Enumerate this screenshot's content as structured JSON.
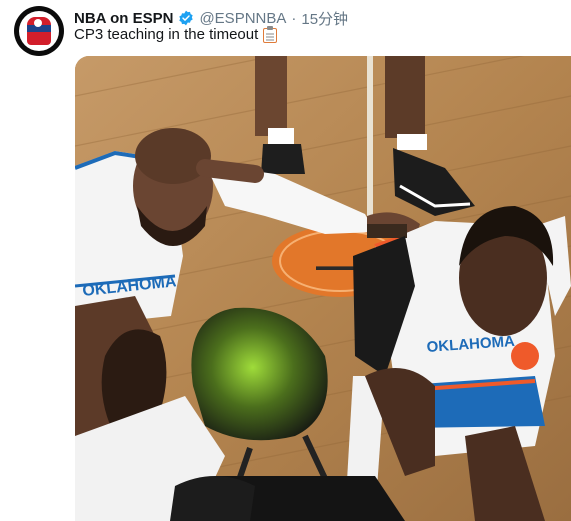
{
  "tweet": {
    "author_name": "NBA on ESPN",
    "handle": "@ESPNNBA",
    "separator": "·",
    "timestamp": "15分钟",
    "text": "CP3 teaching in the timeout",
    "emoji": "clipboard-emoji",
    "verified": true
  },
  "media": {
    "jersey_text_left": "OKLAHOMA",
    "jersey_text_right": "OKLAHOMA"
  },
  "colors": {
    "verified_blue": "#1da1f2",
    "text_primary": "#14171a",
    "text_secondary": "#657786",
    "thunder_blue": "#1d6bb8",
    "thunder_orange": "#ef5a2a"
  }
}
